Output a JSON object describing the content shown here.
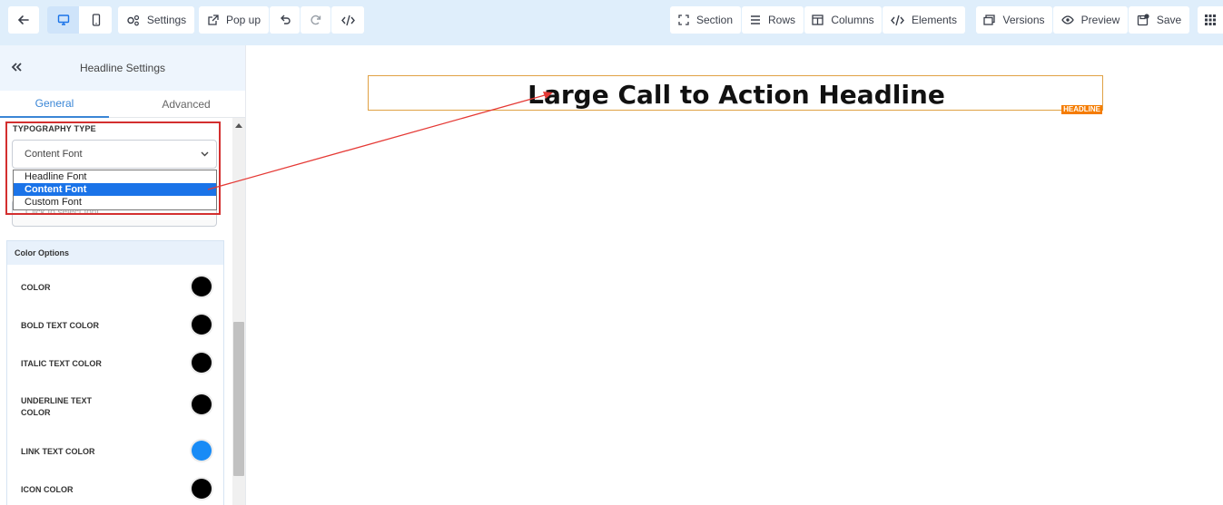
{
  "toolbar": {
    "left": {
      "back": "back-arrow-icon",
      "desktop": "desktop-icon",
      "mobile": "mobile-icon",
      "settings_label": "Settings",
      "popup_label": "Pop up",
      "undo": "undo-icon",
      "redo": "redo-icon",
      "code": "code-icon"
    },
    "right": {
      "section_label": "Section",
      "rows_label": "Rows",
      "columns_label": "Columns",
      "elements_label": "Elements",
      "versions_label": "Versions",
      "preview_label": "Preview",
      "save_label": "Save",
      "apps": "grid-icon"
    }
  },
  "sidebar": {
    "title": "Headline Settings",
    "tabs": [
      {
        "label": "General",
        "active": true
      },
      {
        "label": "Advanced",
        "active": false
      }
    ],
    "typography": {
      "label": "TYPOGRAPHY TYPE",
      "selected": "Content Font",
      "options": [
        "Headline Font",
        "Content Font",
        "Custom Font"
      ],
      "hidden_field_text": "Click to select font"
    },
    "color_options": {
      "title": "Color Options",
      "rows": [
        {
          "label": "COLOR",
          "color": "#000000"
        },
        {
          "label": "BOLD TEXT COLOR",
          "color": "#000000"
        },
        {
          "label": "ITALIC TEXT COLOR",
          "color": "#000000"
        },
        {
          "label": "UNDERLINE TEXT COLOR",
          "color": "#000000"
        },
        {
          "label": "LINK TEXT COLOR",
          "color": "#188bf6"
        },
        {
          "label": "ICON COLOR",
          "color": "#000000"
        }
      ]
    }
  },
  "canvas": {
    "headline_text": "Large Call to Action Headline",
    "element_badge": "HEADLINE"
  },
  "colors": {
    "toolbar_bg": "#dfeefb",
    "accent": "#3a86d6",
    "annotation": "#d32f2f",
    "headline_border": "#e0a144",
    "badge": "#f57c00"
  }
}
